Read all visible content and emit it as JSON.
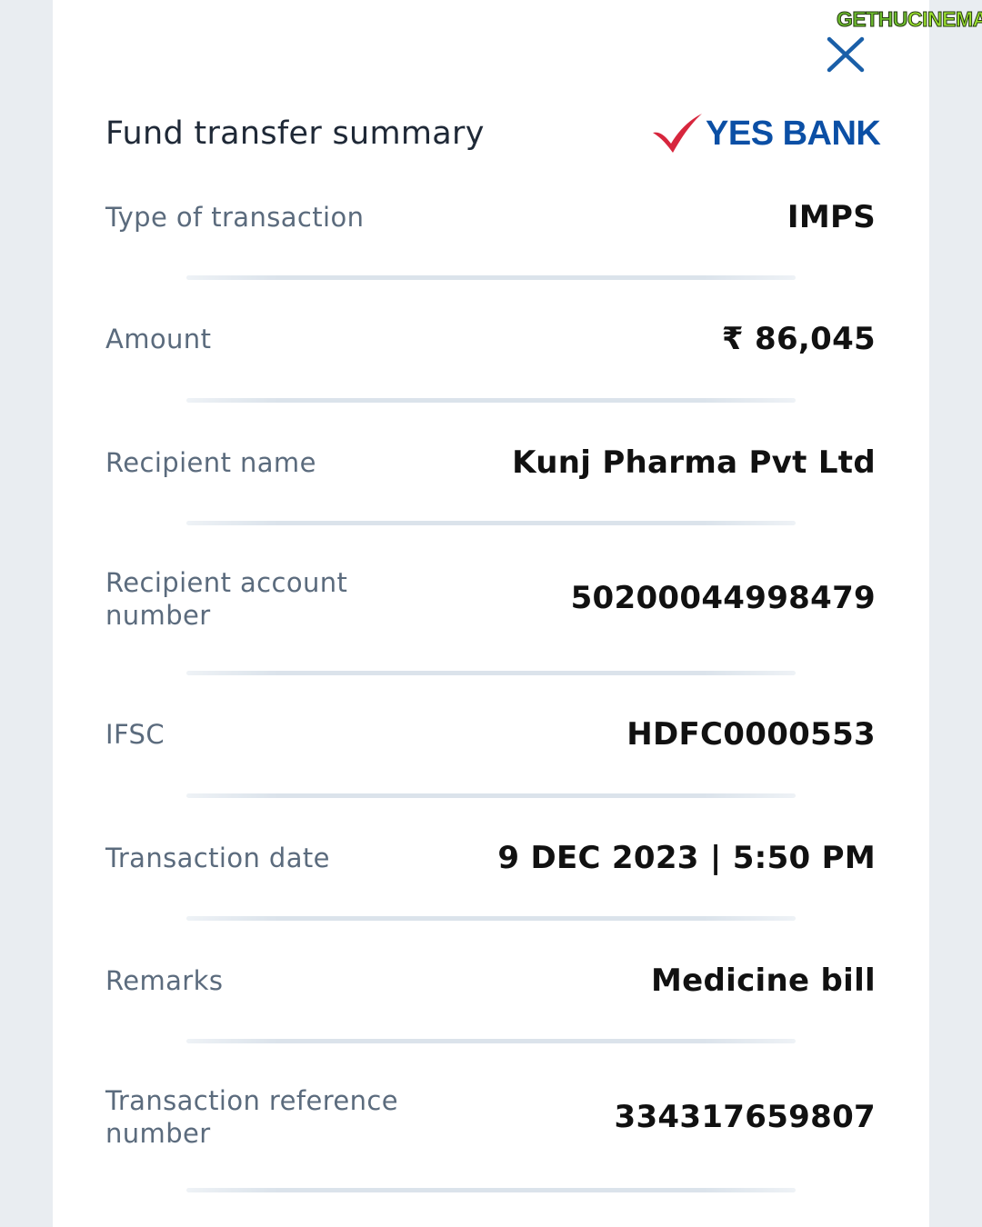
{
  "header": {
    "title": "Fund transfer summary",
    "bank_logo_text": "YES BANK",
    "close_icon": "close-icon"
  },
  "watermark": {
    "part1": "GETHU",
    "part2": "CINEMA"
  },
  "details": [
    {
      "label": "Type of transaction",
      "value": "IMPS"
    },
    {
      "label": "Amount",
      "value": "₹ 86,045"
    },
    {
      "label": "Recipient name",
      "value": "Kunj Pharma Pvt Ltd"
    },
    {
      "label": "Recipient account number",
      "value": "50200044998479"
    },
    {
      "label": "IFSC",
      "value": "HDFC0000553"
    },
    {
      "label": "Transaction date",
      "value": "9 DEC 2023 | 5:50 PM"
    },
    {
      "label": "Remarks",
      "value": "Medicine bill"
    },
    {
      "label": "Transaction reference number",
      "value": "334317659807"
    }
  ],
  "colors": {
    "logo_blue": "#0b4fa5",
    "logo_red": "#d7263d",
    "close_blue": "#1a5fa8"
  }
}
